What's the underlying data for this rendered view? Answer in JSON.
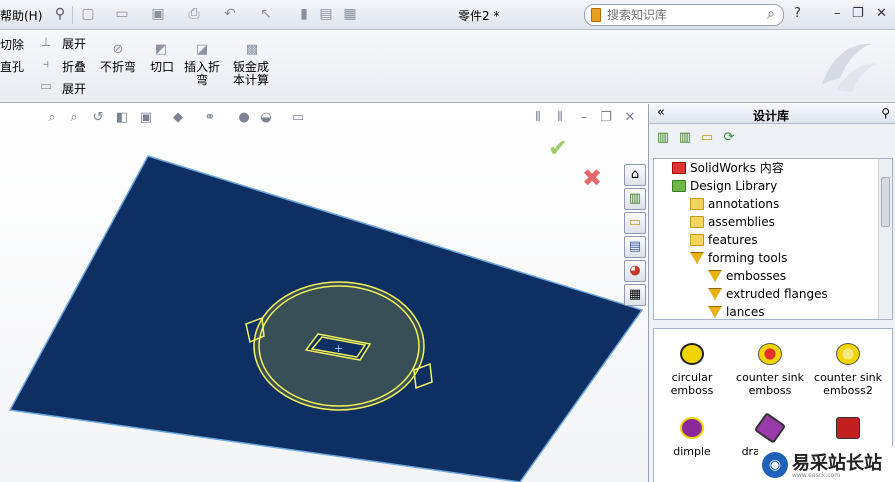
{
  "menubar": {
    "help_label": "帮助(H)",
    "doc_title": "零件2 *",
    "search_placeholder": "搜索知识库"
  },
  "ribbon": {
    "left_col": [
      "切除",
      "直孔"
    ],
    "sheet_col": [
      "展开",
      "折叠",
      "展开"
    ],
    "unfold_label": "不折弯",
    "cut_label": "切口",
    "insert_bend_label_1": "插入折",
    "insert_bend_label_2": "弯",
    "cost_label_1": "钣金成",
    "cost_label_2": "本计算"
  },
  "design_library": {
    "title": "设计库",
    "tree": [
      {
        "label": "SolidWorks 内容",
        "icon": "sw"
      },
      {
        "label": "Design Library",
        "icon": "lib"
      },
      {
        "label": "annotations",
        "icon": "folder"
      },
      {
        "label": "assemblies",
        "icon": "folder"
      },
      {
        "label": "features",
        "icon": "folder"
      },
      {
        "label": "forming tools",
        "icon": "form"
      },
      {
        "label": "embosses",
        "icon": "form"
      },
      {
        "label": "extruded flanges",
        "icon": "form"
      },
      {
        "label": "lances",
        "icon": "form"
      }
    ],
    "items": [
      {
        "label": "circular emboss",
        "color": "#f2d400"
      },
      {
        "label": "counter sink emboss",
        "color": "#e03030"
      },
      {
        "label": "counter sink emboss2",
        "color": "#f2d400"
      },
      {
        "label": "dimple",
        "color": "#8a2a9a"
      },
      {
        "label": "dra rectan",
        "color": "#9a3aa8"
      },
      {
        "label": "",
        "color": "#c02020"
      }
    ]
  },
  "watermark": {
    "text": "易采站长站",
    "sub": "www.easck.com"
  },
  "colors": {
    "part_face": "#0e2f62",
    "sketch_line": "#f2f25a"
  }
}
